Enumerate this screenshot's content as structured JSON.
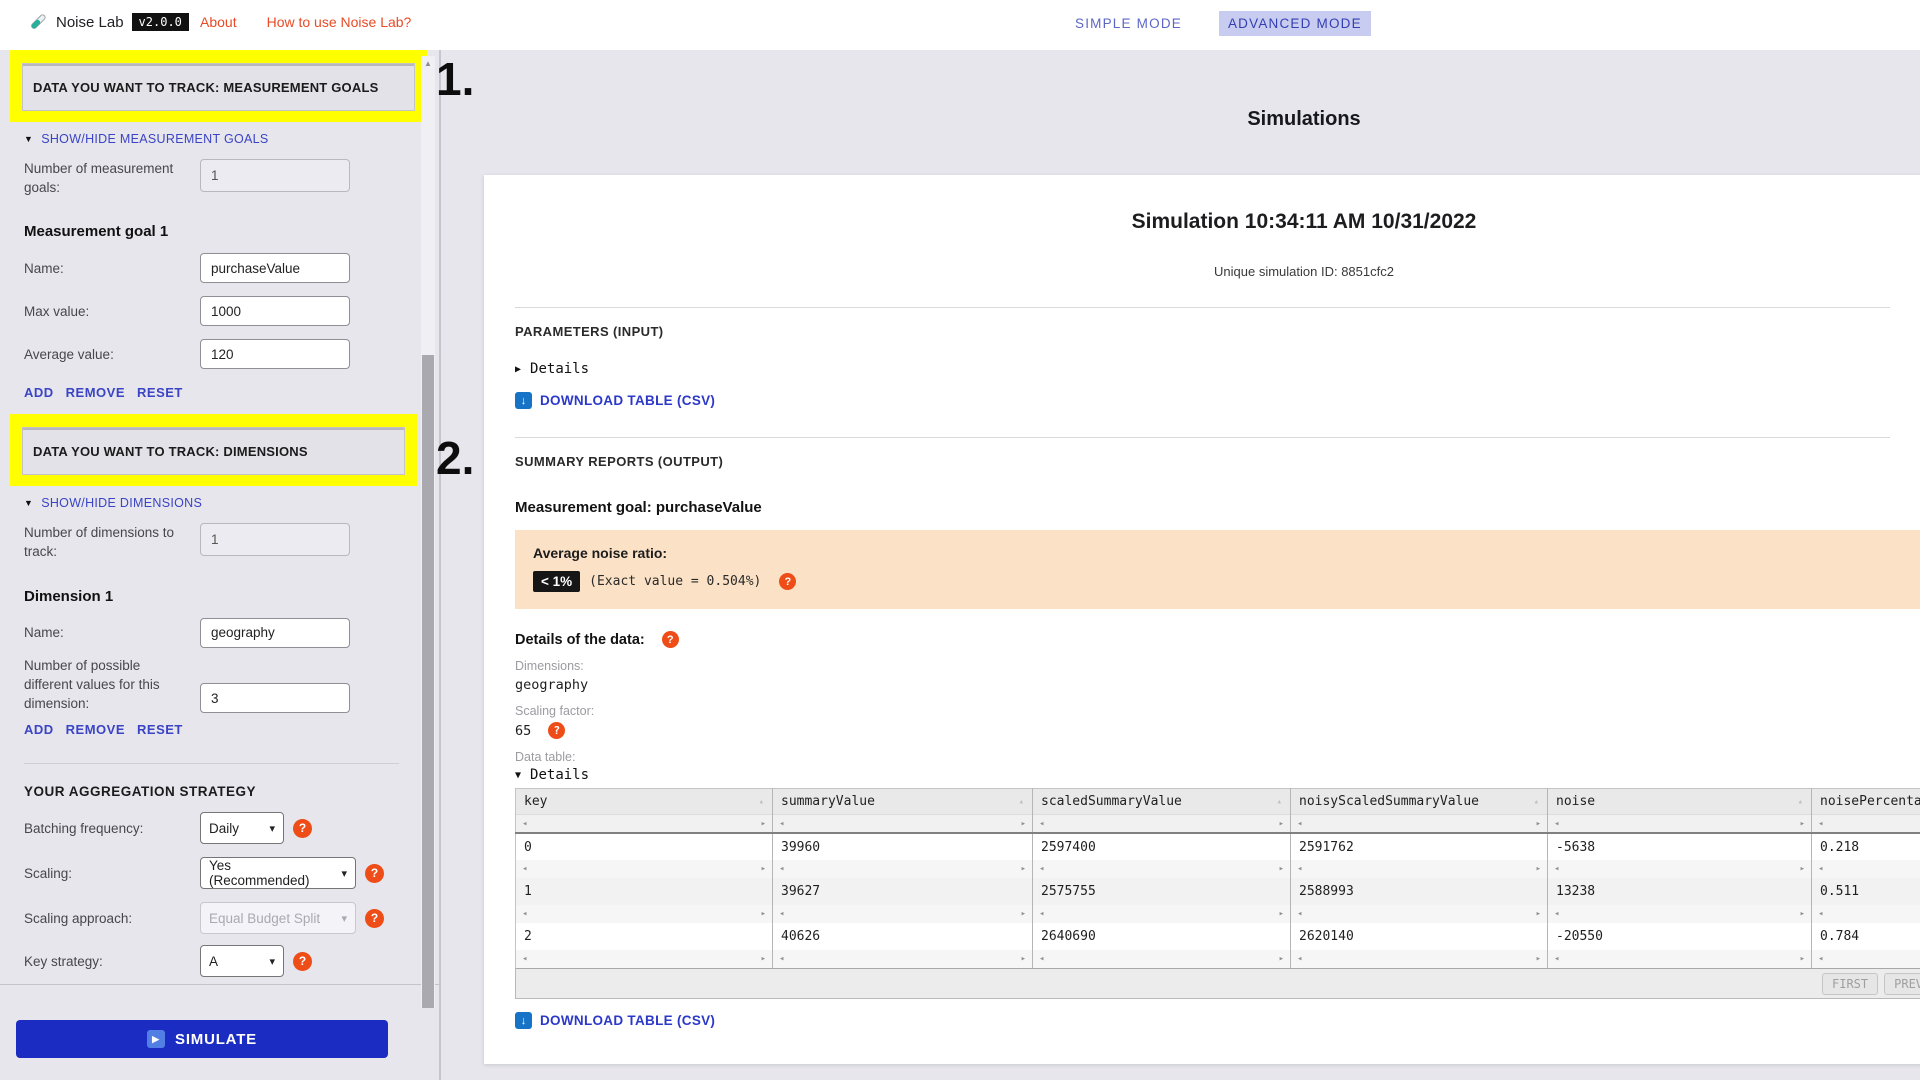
{
  "header": {
    "app_name": "Noise Lab",
    "version": "v2.0.0",
    "nav_about": "About",
    "nav_howto": "How to use Noise Lab?",
    "mode_simple": "SIMPLE MODE",
    "mode_advanced": "ADVANCED MODE"
  },
  "annotations": {
    "step1": "1.",
    "step2": "2."
  },
  "sidebar": {
    "measurement_goals": {
      "section_title": "DATA YOU WANT TO TRACK: MEASUREMENT GOALS",
      "toggle_label": "SHOW/HIDE MEASUREMENT GOALS",
      "count_label": "Number of measurement goals:",
      "count_value": "1",
      "goal_heading": "Measurement goal 1",
      "fields": [
        {
          "label": "Name:",
          "value": "purchaseValue"
        },
        {
          "label": "Max value:",
          "value": "1000"
        },
        {
          "label": "Average value:",
          "value": "120"
        }
      ],
      "actions": [
        "ADD",
        "REMOVE",
        "RESET"
      ]
    },
    "dimensions": {
      "section_title": "DATA YOU WANT TO TRACK: DIMENSIONS",
      "toggle_label": "SHOW/HIDE DIMENSIONS",
      "count_label": "Number of dimensions to track:",
      "count_value": "1",
      "dim_heading": "Dimension 1",
      "name_label": "Name:",
      "name_value": "geography",
      "values_label": "Number of possible different values for this dimension:",
      "values_value": "3",
      "actions": [
        "ADD",
        "REMOVE",
        "RESET"
      ]
    },
    "aggregation": {
      "section_title": "YOUR AGGREGATION STRATEGY",
      "rows": [
        {
          "label": "Batching frequency:",
          "value": "Daily"
        },
        {
          "label": "Scaling:",
          "value": "Yes (Recommended)"
        },
        {
          "label": "Scaling approach:",
          "value": "Equal Budget Split"
        },
        {
          "label": "Key strategy:",
          "value": "A"
        }
      ]
    },
    "simulate_label": "SIMULATE"
  },
  "main": {
    "page_title": "Simulations",
    "sim_title": "Simulation 10:34:11 AM 10/31/2022",
    "sim_id": "Unique simulation ID: 8851cfc2",
    "parameters_heading": "PARAMETERS (INPUT)",
    "details_label": "Details",
    "download_label": "DOWNLOAD TABLE (CSV)",
    "summary_heading": "SUMMARY REPORTS (OUTPUT)",
    "goal_heading": "Measurement goal: purchaseValue",
    "noise": {
      "label": "Average noise ratio:",
      "badge": "< 1%",
      "exact": "(Exact value = 0.504%)"
    },
    "data_details_heading": "Details of the data:",
    "dimensions_label": "Dimensions:",
    "dimensions_value": "geography",
    "scaling_label": "Scaling factor:",
    "scaling_value": "65",
    "data_table_label": "Data table:",
    "pagination": [
      "FIRST",
      "PREV"
    ]
  },
  "table": {
    "columns": [
      "key",
      "summaryValue",
      "scaledSummaryValue",
      "noisyScaledSummaryValue",
      "noise",
      "noisePercentage"
    ],
    "rows": [
      [
        "0",
        "39960",
        "2597400",
        "2591762",
        "-5638",
        "0.218"
      ],
      [
        "1",
        "39627",
        "2575755",
        "2588993",
        "13238",
        "0.511"
      ],
      [
        "2",
        "40626",
        "2640690",
        "2620140",
        "-20550",
        "0.784"
      ]
    ]
  },
  "colors": {
    "accent_blue": "#3a44c4",
    "nav_orange": "#e84b26",
    "simulate_blue": "#1b2cc3",
    "help_orange": "#ee4d18",
    "panel_peach": "#fbe2c6",
    "highlight_yellow": "#ffff00",
    "mode_badge_bg": "#c8ccf1"
  }
}
